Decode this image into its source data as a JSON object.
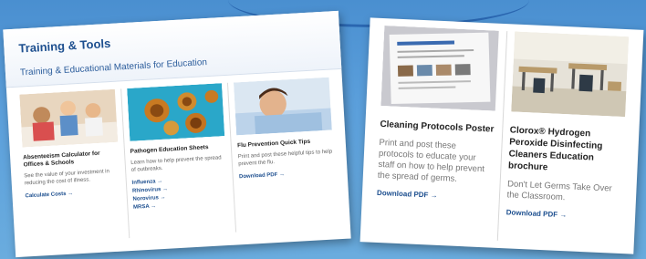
{
  "training": {
    "title": "Training & Tools",
    "subtitle": "Training & Educational Materials for Education",
    "items": [
      {
        "title": "Absenteeism Calculator for Offices & Schools",
        "desc": "See the value of your investment in reducing the cost of illness.",
        "links": [
          "Calculate Costs →"
        ]
      },
      {
        "title": "Pathogen Education Sheets",
        "desc": "Learn how to help prevent the spread of outbreaks.",
        "links": [
          "Influenza →",
          "Rhinovirus →",
          "Norovirus →",
          "MRSA →"
        ]
      },
      {
        "title": "Flu Prevention Quick Tips",
        "desc": "Print and post these helpful tips to help prevent the flu.",
        "links": [
          "Download PDF →"
        ]
      }
    ]
  },
  "resources": [
    {
      "title": "Cleaning Protocols Poster",
      "desc": "Print and post these protocols to educate your staff on how to help prevent the spread of germs.",
      "link": "Download PDF →",
      "thumb_caption": "Cleaning Protocols Poster"
    },
    {
      "title": "Clorox® Hydrogen Peroxide Disinfecting Cleaners Education brochure",
      "desc": "Don't Let Germs Take Over the Classroom.",
      "link": "Download PDF →"
    }
  ],
  "colors": {
    "accent": "#1d4f8f",
    "background": "#5b9fdb"
  }
}
